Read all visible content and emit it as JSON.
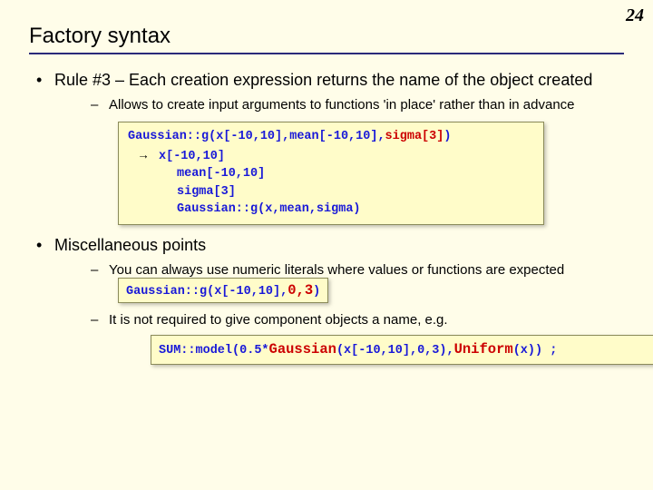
{
  "page_number": "24",
  "title": "Factory syntax",
  "bullets": {
    "rule3": "Rule #3 – Each creation expression returns the name of the object created",
    "rule3_sub": "Allows to create input arguments to functions 'in place' rather than in advance",
    "misc": "Miscellaneous points",
    "misc_sub1_a": "You can always use numeric literals where values or functions are expected",
    "misc_sub2": "It is not required to give component objects a name, e.g."
  },
  "code": {
    "box1_l1a": "Gaussian::g(x[-10,10],mean[-10,10],",
    "box1_l1b": "sigma[3]",
    "box1_l1c": ")",
    "box1_l2": "x[-10,10]",
    "box1_l3": "mean[-10,10]",
    "box1_l4": "sigma[3]",
    "box1_l5": "Gaussian::g(x,mean,sigma)",
    "arrow": "→",
    "box2_a": "Gaussian::g(x[-10,10],",
    "box2_b": "0,3",
    "box2_c": ")",
    "box3_a": "SUM::model(0.5*",
    "box3_b": "Gaussian",
    "box3_c": "(x[-10,10],0,3),",
    "box3_d": "Uniform",
    "box3_e": "(x)) ;"
  }
}
